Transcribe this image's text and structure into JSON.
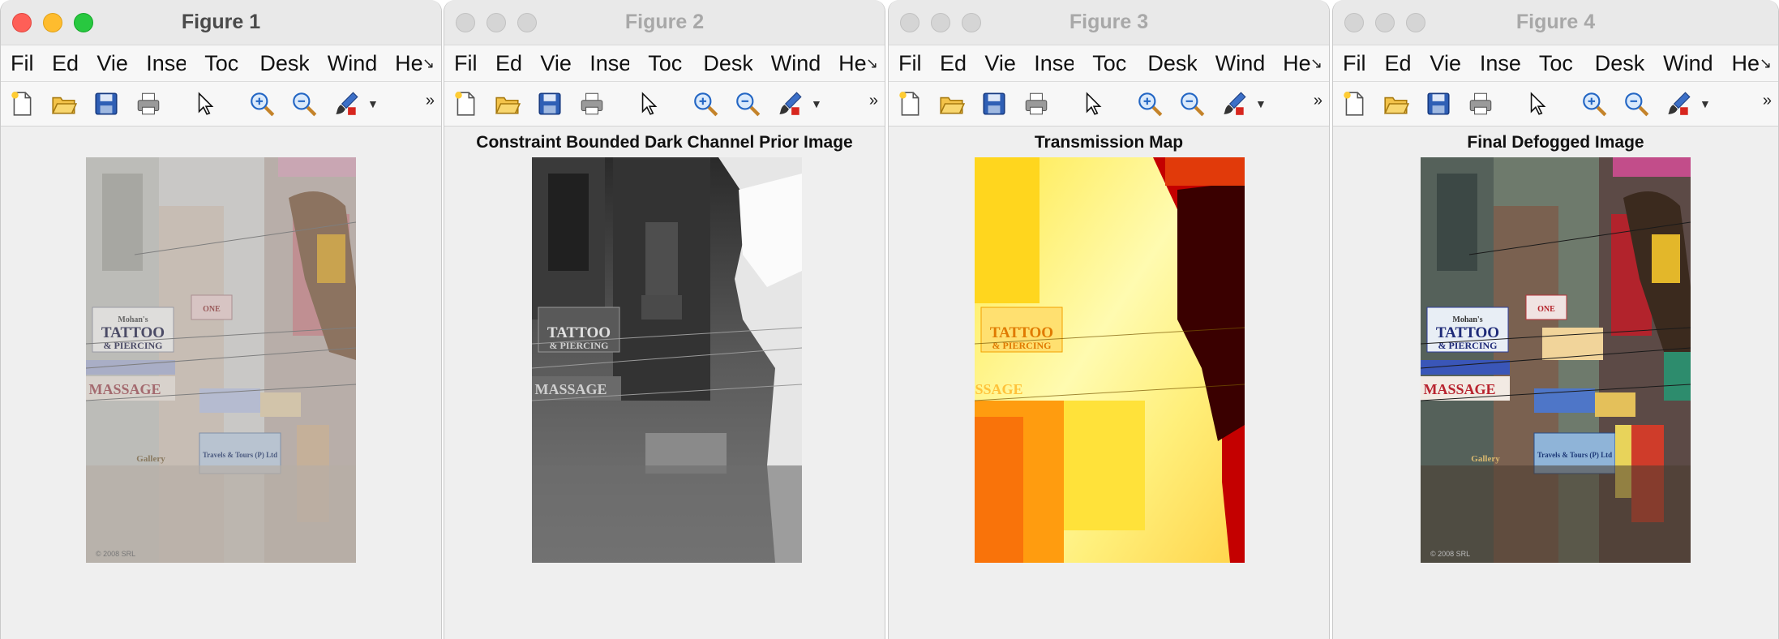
{
  "windows": [
    {
      "title": "Figure 1",
      "plot_title": "",
      "menu": [
        "Fil",
        "Ed",
        "Vie",
        "Inse",
        "Toc",
        "Desk",
        "Wind",
        "He"
      ]
    },
    {
      "title": "Figure 2",
      "plot_title": "Constraint Bounded Dark Channel Prior Image",
      "menu": [
        "Fil",
        "Ed",
        "Vie",
        "Inse",
        "Toc",
        "Desk",
        "Wind",
        "He"
      ]
    },
    {
      "title": "Figure 3",
      "plot_title": "Transmission Map",
      "menu": [
        "Fil",
        "Ed",
        "Vie",
        "Inse",
        "Toc",
        "Desk",
        "Wind",
        "He"
      ]
    },
    {
      "title": "Figure 4",
      "plot_title": "Final Defogged Image",
      "menu": [
        "Fil",
        "Ed",
        "Vie",
        "Inse",
        "Toc",
        "Desk",
        "Wind",
        "He"
      ]
    }
  ],
  "overflow_glyph": "»",
  "menu_overflow_glyph": "↘",
  "image_signs": {
    "tattoo": "TATTOO",
    "piercing": "& PIERCING",
    "mohans": "Mohan's",
    "massage": "MASSAGE",
    "one": "ONE",
    "travels": "Travels & Tours (P) Ltd",
    "gallery": "Gallery",
    "copyright": "© 2008 SRL"
  },
  "toolbar_icons": [
    "new-file-icon",
    "open-folder-icon",
    "save-icon",
    "print-icon",
    "pointer-icon",
    "zoom-in-icon",
    "zoom-out-icon",
    "brush-icon"
  ]
}
